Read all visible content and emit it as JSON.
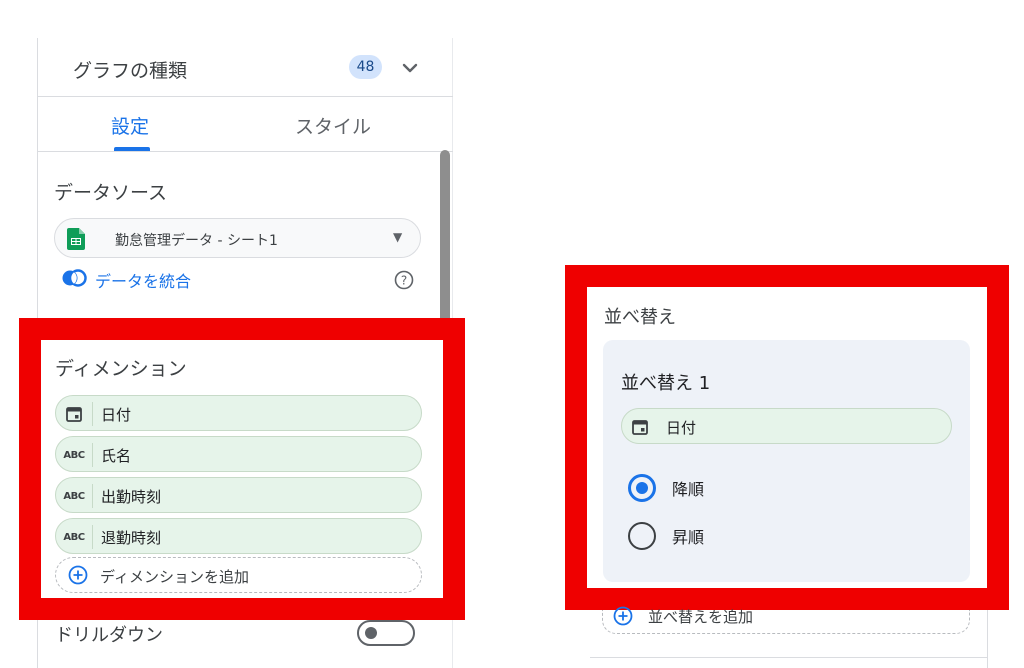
{
  "left_panel": {
    "chart_type": {
      "label": "グラフの種類",
      "count": "48",
      "chevron_icon": "chevron-down-icon"
    },
    "tabs": [
      {
        "label": "設定",
        "active": true
      },
      {
        "label": "スタイル",
        "active": false
      }
    ],
    "data_source": {
      "label": "データソース",
      "selected": "勤怠管理データ - シート1",
      "source_icon": "google-sheets-icon",
      "blend_label": "データを統合",
      "help_icon": "help-circle-icon"
    },
    "dimensions": {
      "label": "ディメンション",
      "items": [
        {
          "icon": "calendar-icon",
          "label": "日付"
        },
        {
          "icon": "abc-text-icon",
          "icon_text": "ABC",
          "label": "氏名"
        },
        {
          "icon": "abc-text-icon",
          "icon_text": "ABC",
          "label": "出勤時刻"
        },
        {
          "icon": "abc-text-icon",
          "icon_text": "ABC",
          "label": "退勤時刻"
        }
      ],
      "add_label": "ディメンションを追加"
    },
    "drilldown": {
      "label": "ドリルダウン",
      "enabled": false
    }
  },
  "sort_panel": {
    "title": "並べ替え",
    "sort_1": {
      "label": "並べ替え 1",
      "field": {
        "icon": "calendar-icon",
        "label": "日付"
      },
      "options": [
        {
          "label": "降順",
          "selected": true
        },
        {
          "label": "昇順",
          "selected": false
        }
      ]
    },
    "add_label": "並べ替えを追加"
  },
  "colors": {
    "accent": "#1a73e8",
    "highlight_frame": "#ef0000",
    "chip_background": "#e6f4ea",
    "badge_background": "#d2e3fc",
    "card_background": "#eef2f8"
  }
}
